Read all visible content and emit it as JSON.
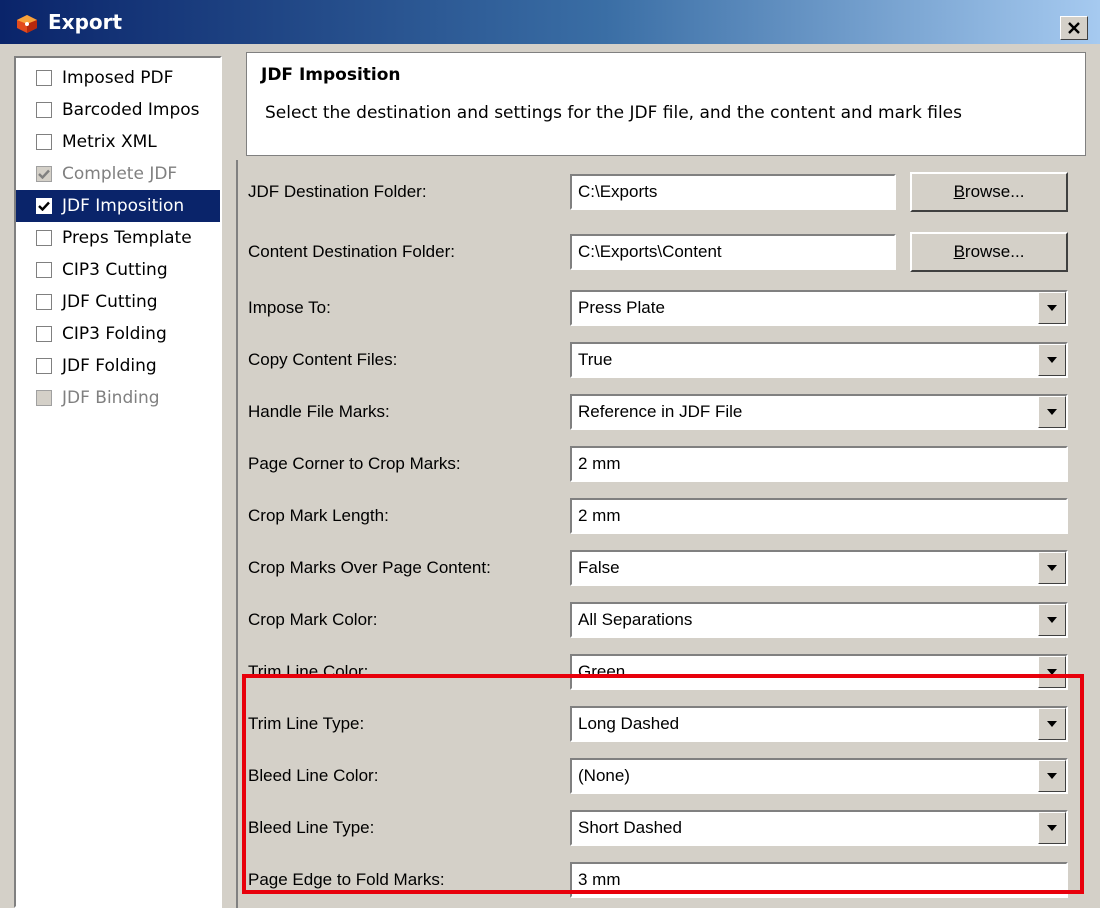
{
  "window": {
    "title": "Export",
    "close_label": "×",
    "icon": "export-app-icon"
  },
  "sidebar": {
    "items": [
      {
        "label": "Imposed PDF",
        "checked": false,
        "state": "normal"
      },
      {
        "label": "Barcoded Impos",
        "checked": false,
        "state": "normal"
      },
      {
        "label": "Metrix XML",
        "checked": false,
        "state": "normal"
      },
      {
        "label": "Complete JDF",
        "checked": true,
        "state": "disabled"
      },
      {
        "label": "JDF Imposition",
        "checked": true,
        "state": "selected"
      },
      {
        "label": "Preps Template",
        "checked": false,
        "state": "normal"
      },
      {
        "label": "CIP3 Cutting",
        "checked": false,
        "state": "normal"
      },
      {
        "label": "JDF Cutting",
        "checked": false,
        "state": "normal"
      },
      {
        "label": "CIP3 Folding",
        "checked": false,
        "state": "normal"
      },
      {
        "label": "JDF Folding",
        "checked": false,
        "state": "normal"
      },
      {
        "label": "JDF Binding",
        "checked": false,
        "state": "disabled"
      }
    ]
  },
  "header": {
    "title": "JDF Imposition",
    "description": "Select the destination and settings for the JDF file, and the content and mark files"
  },
  "browse_label_prefix": "B",
  "browse_label_rest": "rowse...",
  "fields": {
    "jdf_destination": {
      "label": "JDF Destination Folder:",
      "value": "C:\\Exports"
    },
    "content_destination": {
      "label": "Content Destination Folder:",
      "value": "C:\\Exports\\Content"
    },
    "impose_to": {
      "label": "Impose To:",
      "value": "Press Plate"
    },
    "copy_content": {
      "label": "Copy Content Files:",
      "value": "True"
    },
    "handle_marks": {
      "label": "Handle File Marks:",
      "value": "Reference in JDF File"
    },
    "corner_crop": {
      "label": "Page Corner to Crop Marks:",
      "value": "2 mm"
    },
    "crop_length": {
      "label": "Crop Mark Length:",
      "value": "2 mm"
    },
    "crop_over": {
      "label": "Crop Marks Over Page Content:",
      "value": "False"
    },
    "crop_color": {
      "label": "Crop Mark Color:",
      "value": "All Separations"
    },
    "trim_color": {
      "label": "Trim Line Color:",
      "value": "Green"
    },
    "trim_type": {
      "label": "Trim Line Type:",
      "value": "Long Dashed"
    },
    "bleed_color": {
      "label": "Bleed Line Color:",
      "value": "(None)"
    },
    "bleed_type": {
      "label": "Bleed Line Type:",
      "value": "Short Dashed"
    },
    "fold_marks": {
      "label": "Page Edge to Fold Marks:",
      "value": "3 mm"
    }
  },
  "colors": {
    "title_bar": "#0a246a",
    "selection": "#0a246a",
    "highlight_box": "#e8000b",
    "face": "#d4d0c8"
  }
}
